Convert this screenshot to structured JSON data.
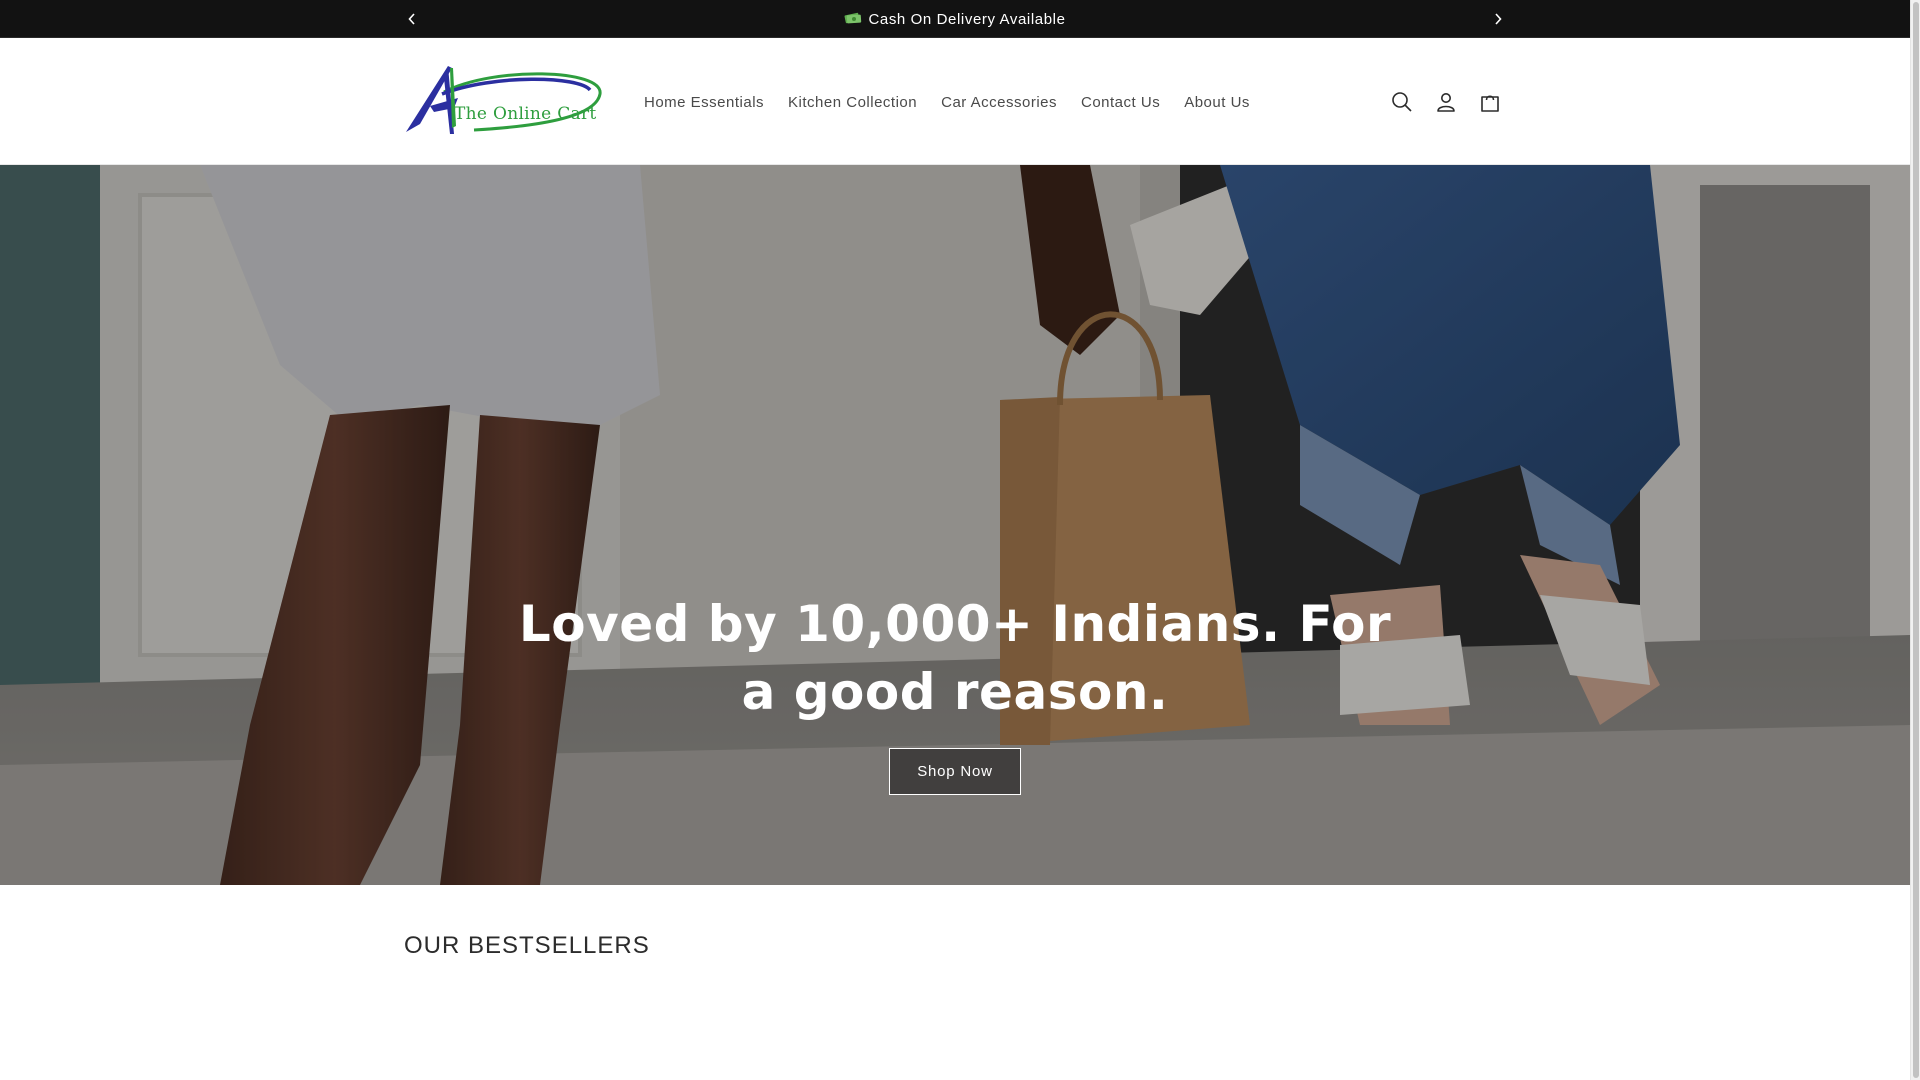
{
  "announcement": {
    "icon": "money-icon",
    "text": "Cash On Delivery Available",
    "prev_label": "‹",
    "next_label": "›"
  },
  "header": {
    "logo": {
      "text": "The Online Cart",
      "colors": {
        "blue": "#2b2fa0",
        "green": "#2e9e3e"
      }
    },
    "nav": [
      {
        "label": "Home Essentials"
      },
      {
        "label": "Kitchen Collection"
      },
      {
        "label": "Car Accessories"
      },
      {
        "label": "Contact Us"
      },
      {
        "label": "About Us"
      }
    ],
    "icons": [
      "search-icon",
      "account-icon",
      "cart-icon"
    ]
  },
  "hero": {
    "headline": "Loved by 10,000+ Indians. For a good reason.",
    "button_label": "Shop Now"
  },
  "section": {
    "title": "OUR BESTSELLERS"
  },
  "colors": {
    "announcement_bg": "#121212",
    "text": "#121212",
    "nav_text": "#4a4a4a"
  }
}
